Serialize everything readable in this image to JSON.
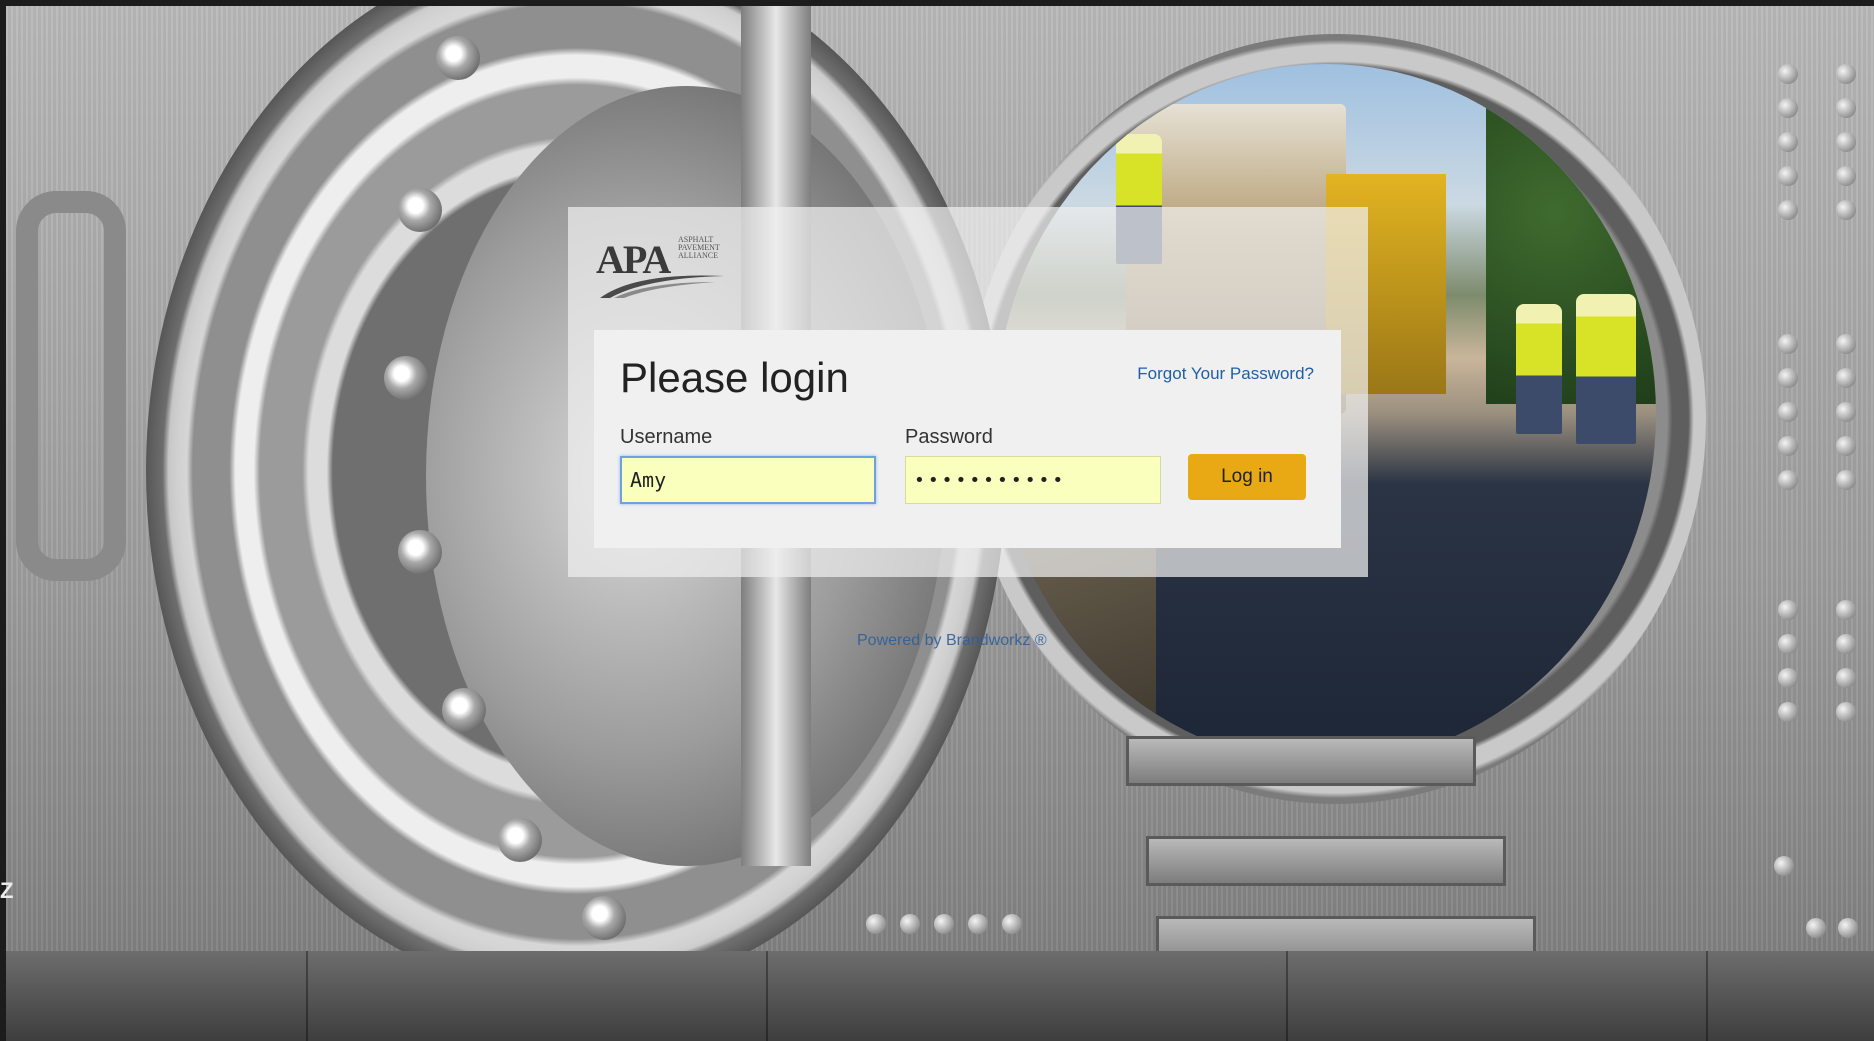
{
  "background": {
    "scene": "open bank vault door revealing road paving crew",
    "icons": [
      "vault-door-icon",
      "stairs-icon",
      "paving-crew-image"
    ]
  },
  "logo": {
    "text": "APA",
    "subtext": "ASPHALT PAVEMENT ALLIANCE"
  },
  "login": {
    "title": "Please login",
    "forgot_label": "Forgot Your Password?",
    "username_label": "Username",
    "username_value": "Amy",
    "password_label": "Password",
    "password_value": "•••••••••••",
    "login_button_label": "Log in"
  },
  "footer": {
    "powered_label": "Powered by Brandworkz ®"
  },
  "edge": {
    "letter": "Z"
  },
  "colors": {
    "accent_button": "#e8a915",
    "link": "#1f5fa6",
    "autofill": "#faffbd"
  }
}
